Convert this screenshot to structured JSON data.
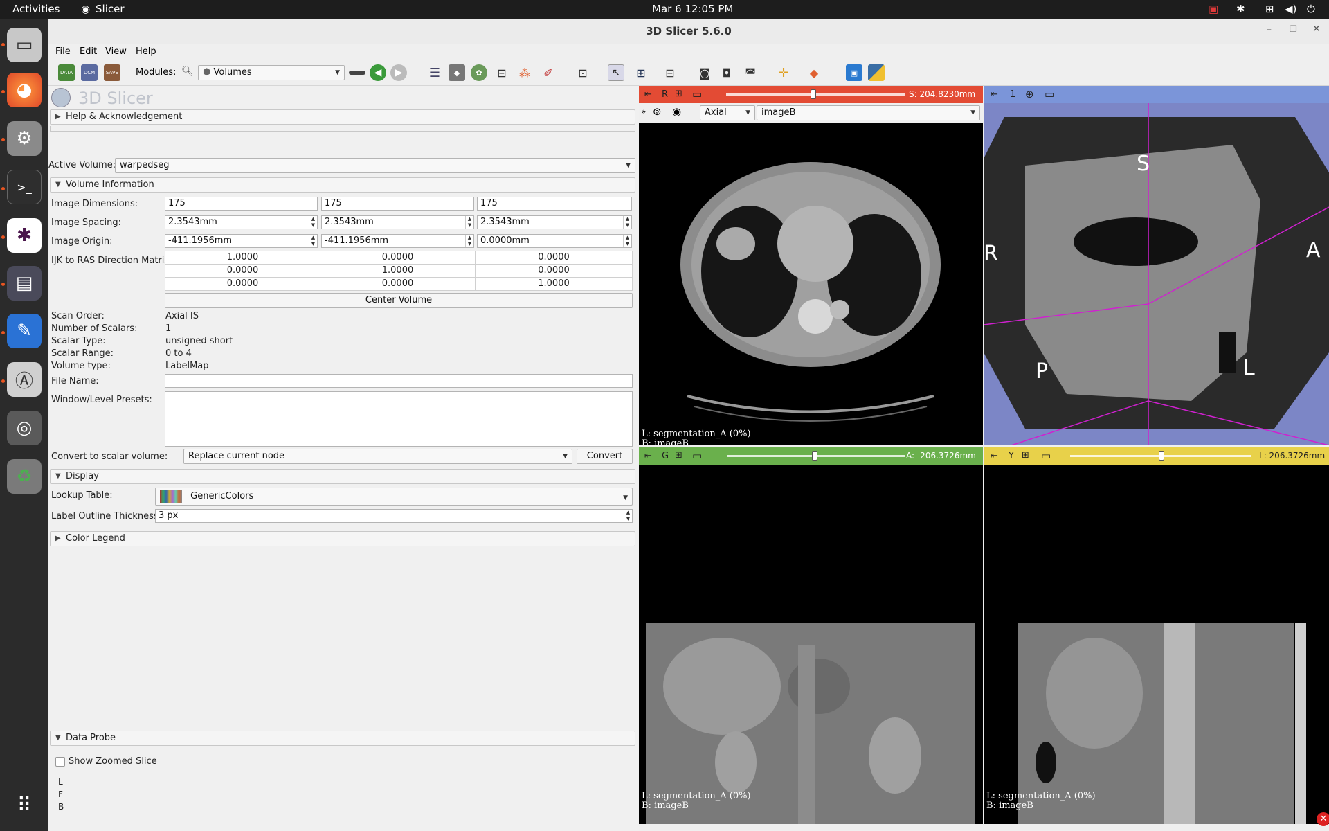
{
  "os": {
    "activities": "Activities",
    "app_name": "Slicer",
    "clock": "Mar 6  12:05 PM"
  },
  "window": {
    "title": "3D Slicer 5.6.0"
  },
  "menu": [
    "File",
    "Edit",
    "View",
    "Help"
  ],
  "toolbar": {
    "modules_label": "Modules:",
    "module_selected": "Volumes",
    "icons": [
      "data-icon",
      "dcm-icon",
      "save-icon",
      "layout-icon",
      "back-icon",
      "forward-icon",
      "list-icon",
      "cube-icon",
      "brain-icon",
      "tree-icon",
      "points-icon",
      "pen-icon",
      "screenshot-icon",
      "pointer-icon",
      "view-icon",
      "crosshair-icon",
      "python-icon"
    ],
    "icon_texts": {
      "data": "DATA",
      "dcm": "DCM",
      "save": "SAVE"
    }
  },
  "panel": {
    "logo_text": "3D Slicer",
    "help_section": "Help & Acknowledgement",
    "active_volume_label": "Active Volume:",
    "active_volume": "warpedseg",
    "volume_info_section": "Volume Information",
    "image_dimensions_label": "Image Dimensions:",
    "image_dimensions": [
      "175",
      "175",
      "175"
    ],
    "image_spacing_label": "Image Spacing:",
    "image_spacing": [
      "2.3543mm",
      "2.3543mm",
      "2.3543mm"
    ],
    "image_origin_label": "Image Origin:",
    "image_origin": [
      "-411.1956mm",
      "-411.1956mm",
      "0.0000mm"
    ],
    "ijk_label": "IJK to RAS Direction Matrix:",
    "ijk_matrix": [
      [
        "1.0000",
        "0.0000",
        "0.0000"
      ],
      [
        "0.0000",
        "1.0000",
        "0.0000"
      ],
      [
        "0.0000",
        "0.0000",
        "1.0000"
      ]
    ],
    "center_volume": "Center Volume",
    "scan_order_label": "Scan Order:",
    "scan_order": "Axial IS",
    "num_scalars_label": "Number of Scalars:",
    "num_scalars": "1",
    "scalar_type_label": "Scalar Type:",
    "scalar_type": "unsigned short",
    "scalar_range_label": "Scalar Range:",
    "scalar_range": "0 to 4",
    "volume_type_label": "Volume type:",
    "volume_type": "LabelMap",
    "file_name_label": "File Name:",
    "file_name": "",
    "wl_presets_label": "Window/Level Presets:",
    "convert_label": "Convert to scalar volume:",
    "convert_option": "Replace current node",
    "convert_button": "Convert",
    "display_section": "Display",
    "lookup_table_label": "Lookup Table:",
    "lookup_table": "GenericColors",
    "outline_label": "Label Outline Thickness:",
    "outline_value": "3 px",
    "color_legend_section": "Color Legend",
    "data_probe_section": "Data Probe",
    "show_zoomed": "Show Zoomed Slice",
    "probe_lines": [
      "L",
      "F",
      "B"
    ]
  },
  "views": {
    "red": {
      "letter": "R",
      "offset": "S: 204.8230mm",
      "orientation": "Axial",
      "volume": "imageB",
      "overlay": [
        "L: segmentation_A (0%)",
        "B: imageB"
      ],
      "color": "#e34b34"
    },
    "threed": {
      "number": "1",
      "labels": [
        "S",
        "R",
        "A",
        "P",
        "L"
      ],
      "color": "#7b95d9"
    },
    "green": {
      "letter": "G",
      "offset": "A: -206.3726mm",
      "overlay": [
        "L: segmentation_A (0%)",
        "B: imageB"
      ],
      "color": "#6ab04c"
    },
    "yellow": {
      "letter": "Y",
      "offset": "L: 206.3726mm",
      "overlay": [
        "L: segmentation_A (0%)",
        "B: imageB"
      ],
      "color": "#e8d14a"
    }
  }
}
